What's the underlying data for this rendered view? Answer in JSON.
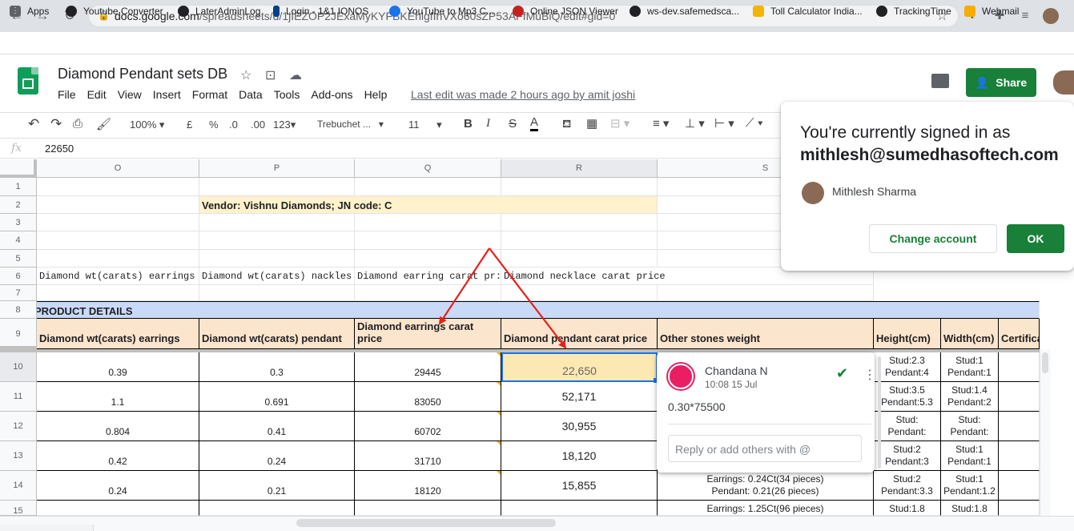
{
  "browser": {
    "url_host": "docs.google.com",
    "url_path": "/spreadsheets/d/1jIEZOP2JExaMyKYFBKEhlgfInVXo60sZP53AFfMuBiQ/edit#gid=0",
    "bookmarks": [
      "Apps",
      "Youtube Converter",
      "LaterAdminLog",
      "Login - 1&1 IONOS",
      "YouTube to Mp3 C...",
      "Online JSON Viewer",
      "ws-dev.safemedsca...",
      "Toll Calculator India...",
      "TrackingTime",
      "Webmail"
    ]
  },
  "doc": {
    "title": "Diamond Pendant sets DB",
    "menu": [
      "File",
      "Edit",
      "View",
      "Insert",
      "Format",
      "Data",
      "Tools",
      "Add-ons",
      "Help"
    ],
    "last_edit": "Last edit was made 2 hours ago by amit joshi",
    "share_label": "Share"
  },
  "toolbar": {
    "zoom": "100%",
    "currency": "£",
    "percent": "%",
    "dec_less": ".0",
    "dec_more": ".00",
    "format_more": "123",
    "font": "Trebuchet ...",
    "font_size": "11"
  },
  "formula_bar": {
    "fx": "fx",
    "value": "22650"
  },
  "grid": {
    "columns": [
      "O",
      "P",
      "Q",
      "R",
      "S"
    ],
    "rows": [
      "1",
      "2",
      "3",
      "4",
      "5",
      "6",
      "7",
      "8",
      "9",
      "10",
      "11",
      "12",
      "13",
      "14",
      "15"
    ],
    "vendor": "Vendor: Vishnu Diamonds; JN code: C",
    "row6": [
      "Diamond wt(carats) earrings",
      "Diamond wt(carats) nackles",
      "Diamond earring carat pr:",
      "Diamond necklace carat price"
    ],
    "product_details": "PRODUCT DETAILS",
    "headers": [
      "Diamond wt(carats) earrings",
      "Diamond wt(carats) pendant",
      "Diamond earrings carat price",
      "Diamond pendant carat price",
      "Other stones weight",
      "Height(cm)",
      "Width(cm)",
      "Certifica"
    ],
    "data": [
      [
        "0.39",
        "0.3",
        "29445",
        "22,650"
      ],
      [
        "1.1",
        "0.691",
        "83050",
        "52,171"
      ],
      [
        "0.804",
        "0.41",
        "60702",
        "30,955"
      ],
      [
        "0.42",
        "0.24",
        "31710",
        "18,120"
      ],
      [
        "0.24",
        "0.21",
        "18120",
        "15,855"
      ]
    ],
    "other_stones_14": [
      "Earrings: 0.24Ct(34 pieces)",
      "Pendant: 0.21(26 pieces)"
    ],
    "other_stones_15": "Earrings: 1.25Ct(96 pieces)",
    "height": [
      [
        "Stud:2.3",
        "Pendant:4"
      ],
      [
        "Stud:3.5",
        "Pendant:5.3"
      ],
      [
        "Stud:",
        "Pendant:"
      ],
      [
        "Stud:2",
        "Pendant:3"
      ],
      [
        "Stud:2",
        "Pendant:3.3"
      ],
      [
        "Stud:1.8",
        ""
      ]
    ],
    "width": [
      [
        "Stud:1",
        "Pendant:1"
      ],
      [
        "Stud:1.4",
        "Pendant:2"
      ],
      [
        "Stud:",
        "Pendant:"
      ],
      [
        "Stud:1",
        "Pendant:1"
      ],
      [
        "Stud:1",
        "Pendant:1.2"
      ],
      [
        "Stud:1.8",
        ""
      ]
    ]
  },
  "comment": {
    "author": "Chandana N",
    "time": "10:08 15 Jul",
    "text": "0.30*75500",
    "reply_placeholder": "Reply or add others with @"
  },
  "account": {
    "line1": "You're currently signed in as",
    "email": "mithlesh@sumedhasoftech.com",
    "name": "Mithlesh Sharma",
    "change_label": "Change account",
    "ok_label": "OK"
  },
  "colors": {
    "accent": "#188038",
    "header_fill": "#fce5cd",
    "vendor_fill": "#fff2cc",
    "section_fill": "#c9daf8",
    "arrow": "#e8201a"
  }
}
